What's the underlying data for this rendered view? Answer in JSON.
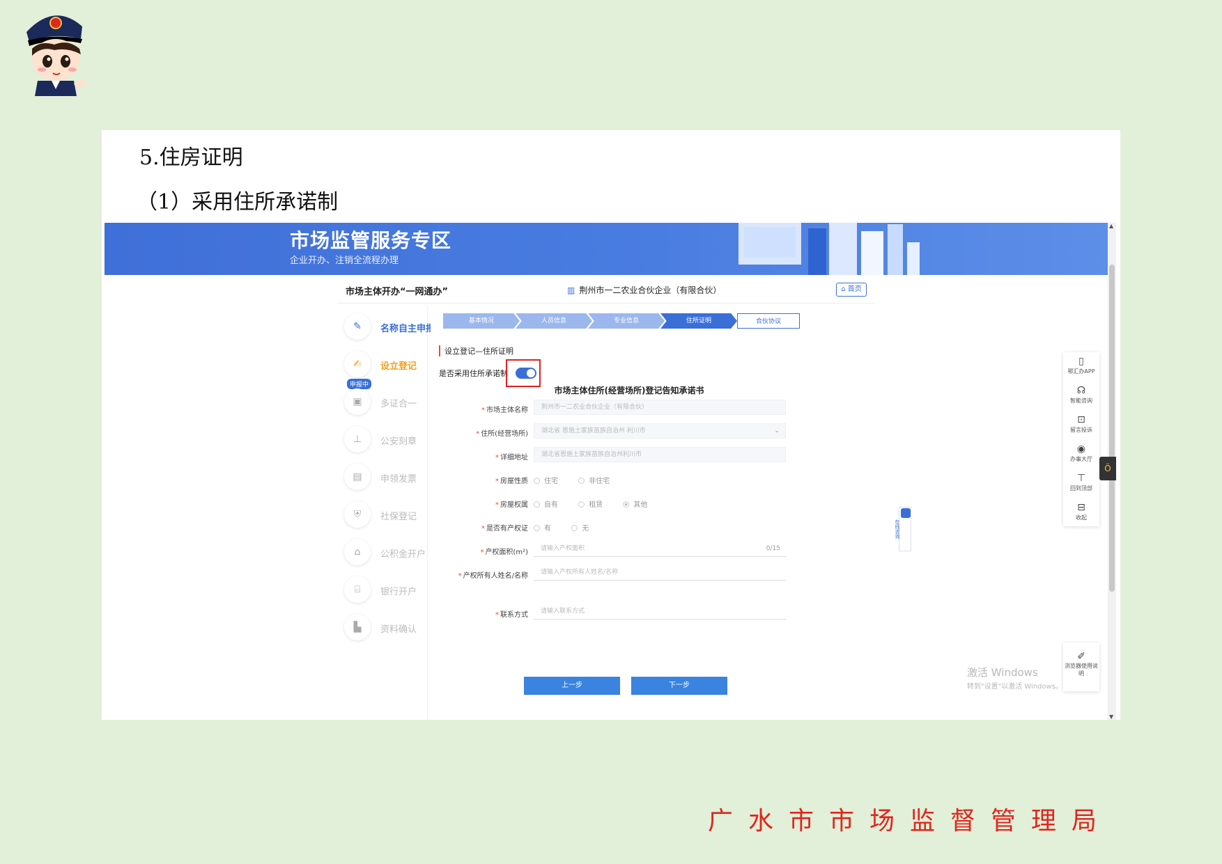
{
  "doc": {
    "heading1": "5.住房证明",
    "heading2": "（1）采用住所承诺制"
  },
  "banner": {
    "title": "市场监管服务专区",
    "subtitle": "企业开办、注销全流程办理"
  },
  "topbar": {
    "left": "市场主体开办“一网通办”",
    "company": "荆州市一二农业合伙企业（有限合伙）",
    "home": "首页"
  },
  "sidebar": [
    {
      "label": "名称自主申报",
      "icon": "edit-icon"
    },
    {
      "label": "设立登记",
      "icon": "form-icon",
      "badge": "申报中"
    },
    {
      "label": "多证合一",
      "icon": "certificate-icon"
    },
    {
      "label": "公安刻章",
      "icon": "stamp-icon"
    },
    {
      "label": "申领发票",
      "icon": "invoice-icon"
    },
    {
      "label": "社保登记",
      "icon": "shield-icon"
    },
    {
      "label": "公积金开户",
      "icon": "house-icon"
    },
    {
      "label": "银行开户",
      "icon": "bank-icon"
    },
    {
      "label": "资料确认",
      "icon": "document-icon"
    }
  ],
  "steps": [
    "基本情况",
    "人员信息",
    "专业信息",
    "住所证明",
    "合伙协议"
  ],
  "form": {
    "section_title": "设立登记—住所证明",
    "promise_label": "是否采用住所承诺制",
    "promise_enabled": true,
    "title": "市场主体住所(经营场所)登记告知承诺书",
    "fields": {
      "name_label": "市场主体名称",
      "name_value": "荆州市一二农业合伙企业（有限合伙）",
      "address_label": "住所(经营场所)",
      "address_value": "湖北省 恩施土家族苗族自治州 利川市",
      "detail_label": "详细地址",
      "detail_value": "湖北省恩施土家族苗族自治州利川市",
      "house_type_label": "房屋性质",
      "house_type_options": [
        "住宅",
        "非住宅"
      ],
      "ownership_label": "房屋权属",
      "ownership_options": [
        "自有",
        "租赁",
        "其他"
      ],
      "cert_label": "是否有产权证",
      "cert_options": [
        "有",
        "无"
      ],
      "area_label": "产权面积(m²)",
      "area_placeholder": "请输入产权面积",
      "area_counter": "0/15",
      "owner_label": "产权所有人姓名/名称",
      "owner_placeholder": "请输入产权所有人姓名/名称",
      "contact_label": "联系方式",
      "contact_placeholder": "请输入联系方式"
    },
    "prev": "上一步",
    "next": "下一步"
  },
  "float_consult": "在线咨询",
  "rtool": [
    "鄂汇办APP",
    "智能咨询",
    "留言投诉",
    "办事大厅",
    "回到顶部",
    "收起"
  ],
  "rtool2": "浏览器使用说明",
  "watermark": {
    "line1": "激活 Windows",
    "line2": "转到\"设置\"以激活 Windows。"
  },
  "footer": "广水市市场监督管理局"
}
